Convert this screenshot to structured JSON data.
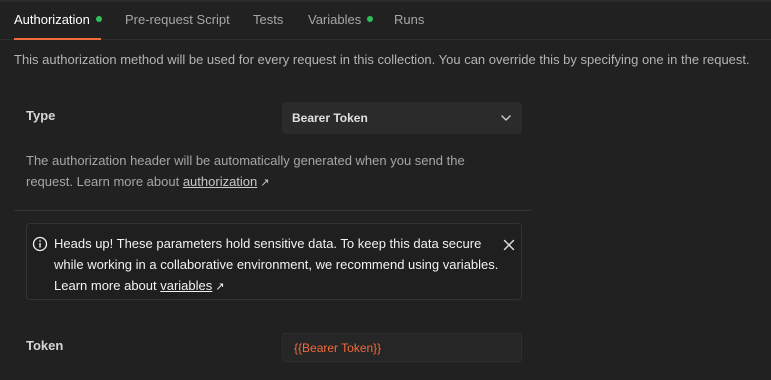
{
  "tabs": [
    {
      "label": "Authorization",
      "active": true,
      "has_dot": true
    },
    {
      "label": "Pre-request Script",
      "active": false,
      "has_dot": false
    },
    {
      "label": "Tests",
      "active": false,
      "has_dot": false
    },
    {
      "label": "Variables",
      "active": false,
      "has_dot": true
    },
    {
      "label": "Runs",
      "active": false,
      "has_dot": false
    }
  ],
  "description": "This authorization method will be used for every request in this collection. You can override this by specifying one in the request.",
  "type": {
    "label": "Type",
    "value": "Bearer Token",
    "icon": "chevron-down-icon"
  },
  "help": {
    "text": "The authorization header will be automatically generated when you send the request. Learn more about ",
    "link": "authorization",
    "arrow": "↗"
  },
  "alert": {
    "icon": "info-icon",
    "text": "Heads up! These parameters hold sensitive data. To keep this data secure while working in a collaborative environment, we recommend using variables. Learn more about ",
    "link": "variables",
    "arrow": "↗",
    "close_icon": "close-icon"
  },
  "token": {
    "label": "Token",
    "value": "{{Bearer Token}}"
  },
  "colors": {
    "accent": "#f26b3a",
    "dot": "#2ec05c",
    "background": "#212121"
  }
}
